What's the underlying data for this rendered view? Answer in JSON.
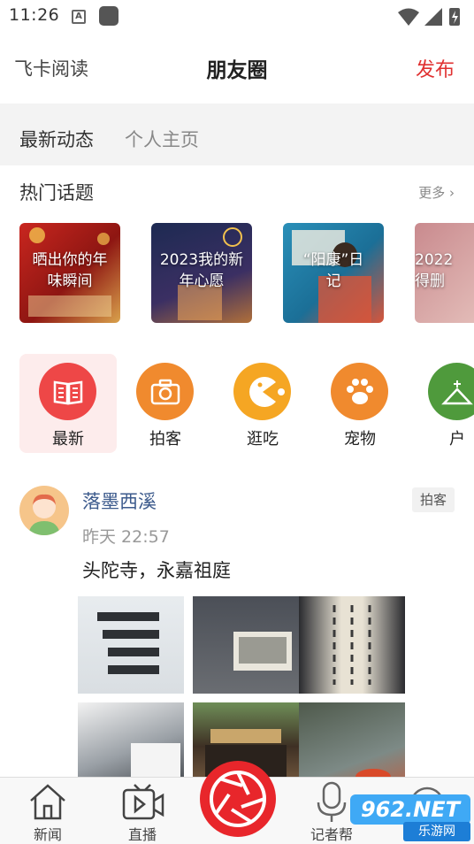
{
  "status_bar": {
    "time": "11:26",
    "notification_letter": "A"
  },
  "header": {
    "left_label": "飞卡阅读",
    "title": "朋友圈",
    "publish_label": "发布"
  },
  "tabs": [
    {
      "label": "最新动态",
      "active": true
    },
    {
      "label": "个人主页",
      "active": false
    }
  ],
  "hot_topics": {
    "heading": "热门话题",
    "more_label": "更多",
    "cards": [
      {
        "line1": "晒出你的年",
        "line2": "味瞬间"
      },
      {
        "line1": "2023我的新",
        "line2": "年心愿"
      },
      {
        "line1": "“阳康”日",
        "line2": "记"
      },
      {
        "line1": "2022",
        "line2": "得删"
      }
    ]
  },
  "categories": [
    {
      "label": "最新",
      "icon": "book-icon",
      "color": "#ee4747",
      "active": true
    },
    {
      "label": "拍客",
      "icon": "camera-icon",
      "color": "#f08a2e",
      "active": false
    },
    {
      "label": "逛吃",
      "icon": "pacman-icon",
      "color": "#f5a623",
      "active": false
    },
    {
      "label": "宠物",
      "icon": "paw-icon",
      "color": "#f08a2e",
      "active": false
    },
    {
      "label": "户",
      "icon": "outdoor-icon",
      "color": "#4f9a3c",
      "active": false
    }
  ],
  "post": {
    "author": "落墨西溪",
    "tag": "拍客",
    "time": "昨天  22:57",
    "text": "头陀寺，永嘉祖庭",
    "photo_count": 6
  },
  "bottom_nav": [
    {
      "label": "新闻",
      "icon": "home-icon"
    },
    {
      "label": "直播",
      "icon": "video-icon"
    },
    {
      "label": "",
      "icon": "shutter-icon"
    },
    {
      "label": "记者帮",
      "icon": "microphone-icon"
    },
    {
      "label": "",
      "icon": "partial-icon"
    }
  ],
  "watermark": {
    "main": "962.NET",
    "sub": "乐游网"
  },
  "colors": {
    "accent": "#e03131",
    "tab_bg": "#f3f3f3",
    "author": "#3c5a8c"
  }
}
